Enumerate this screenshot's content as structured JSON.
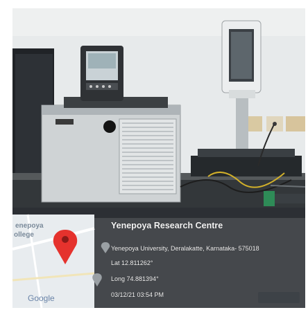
{
  "overlay": {
    "title": "Yenepoya Research Centre",
    "address": "Yenepoya University, Deralakatte, Karnataka- 575018",
    "lat": "Lat 12.811262°",
    "long": "Long 74.881394°",
    "timestamp": "03/12/21 03:54 PM"
  },
  "map": {
    "place_label_1": "enepoya",
    "place_label_2": "ollege",
    "logo": "Google",
    "pin_icon": "map-pin-icon"
  },
  "colors": {
    "wall": "#e9ecec",
    "overlay_bg": "#2b2f33",
    "pin": "#e5322d",
    "accent_green": "#2e8b57"
  }
}
